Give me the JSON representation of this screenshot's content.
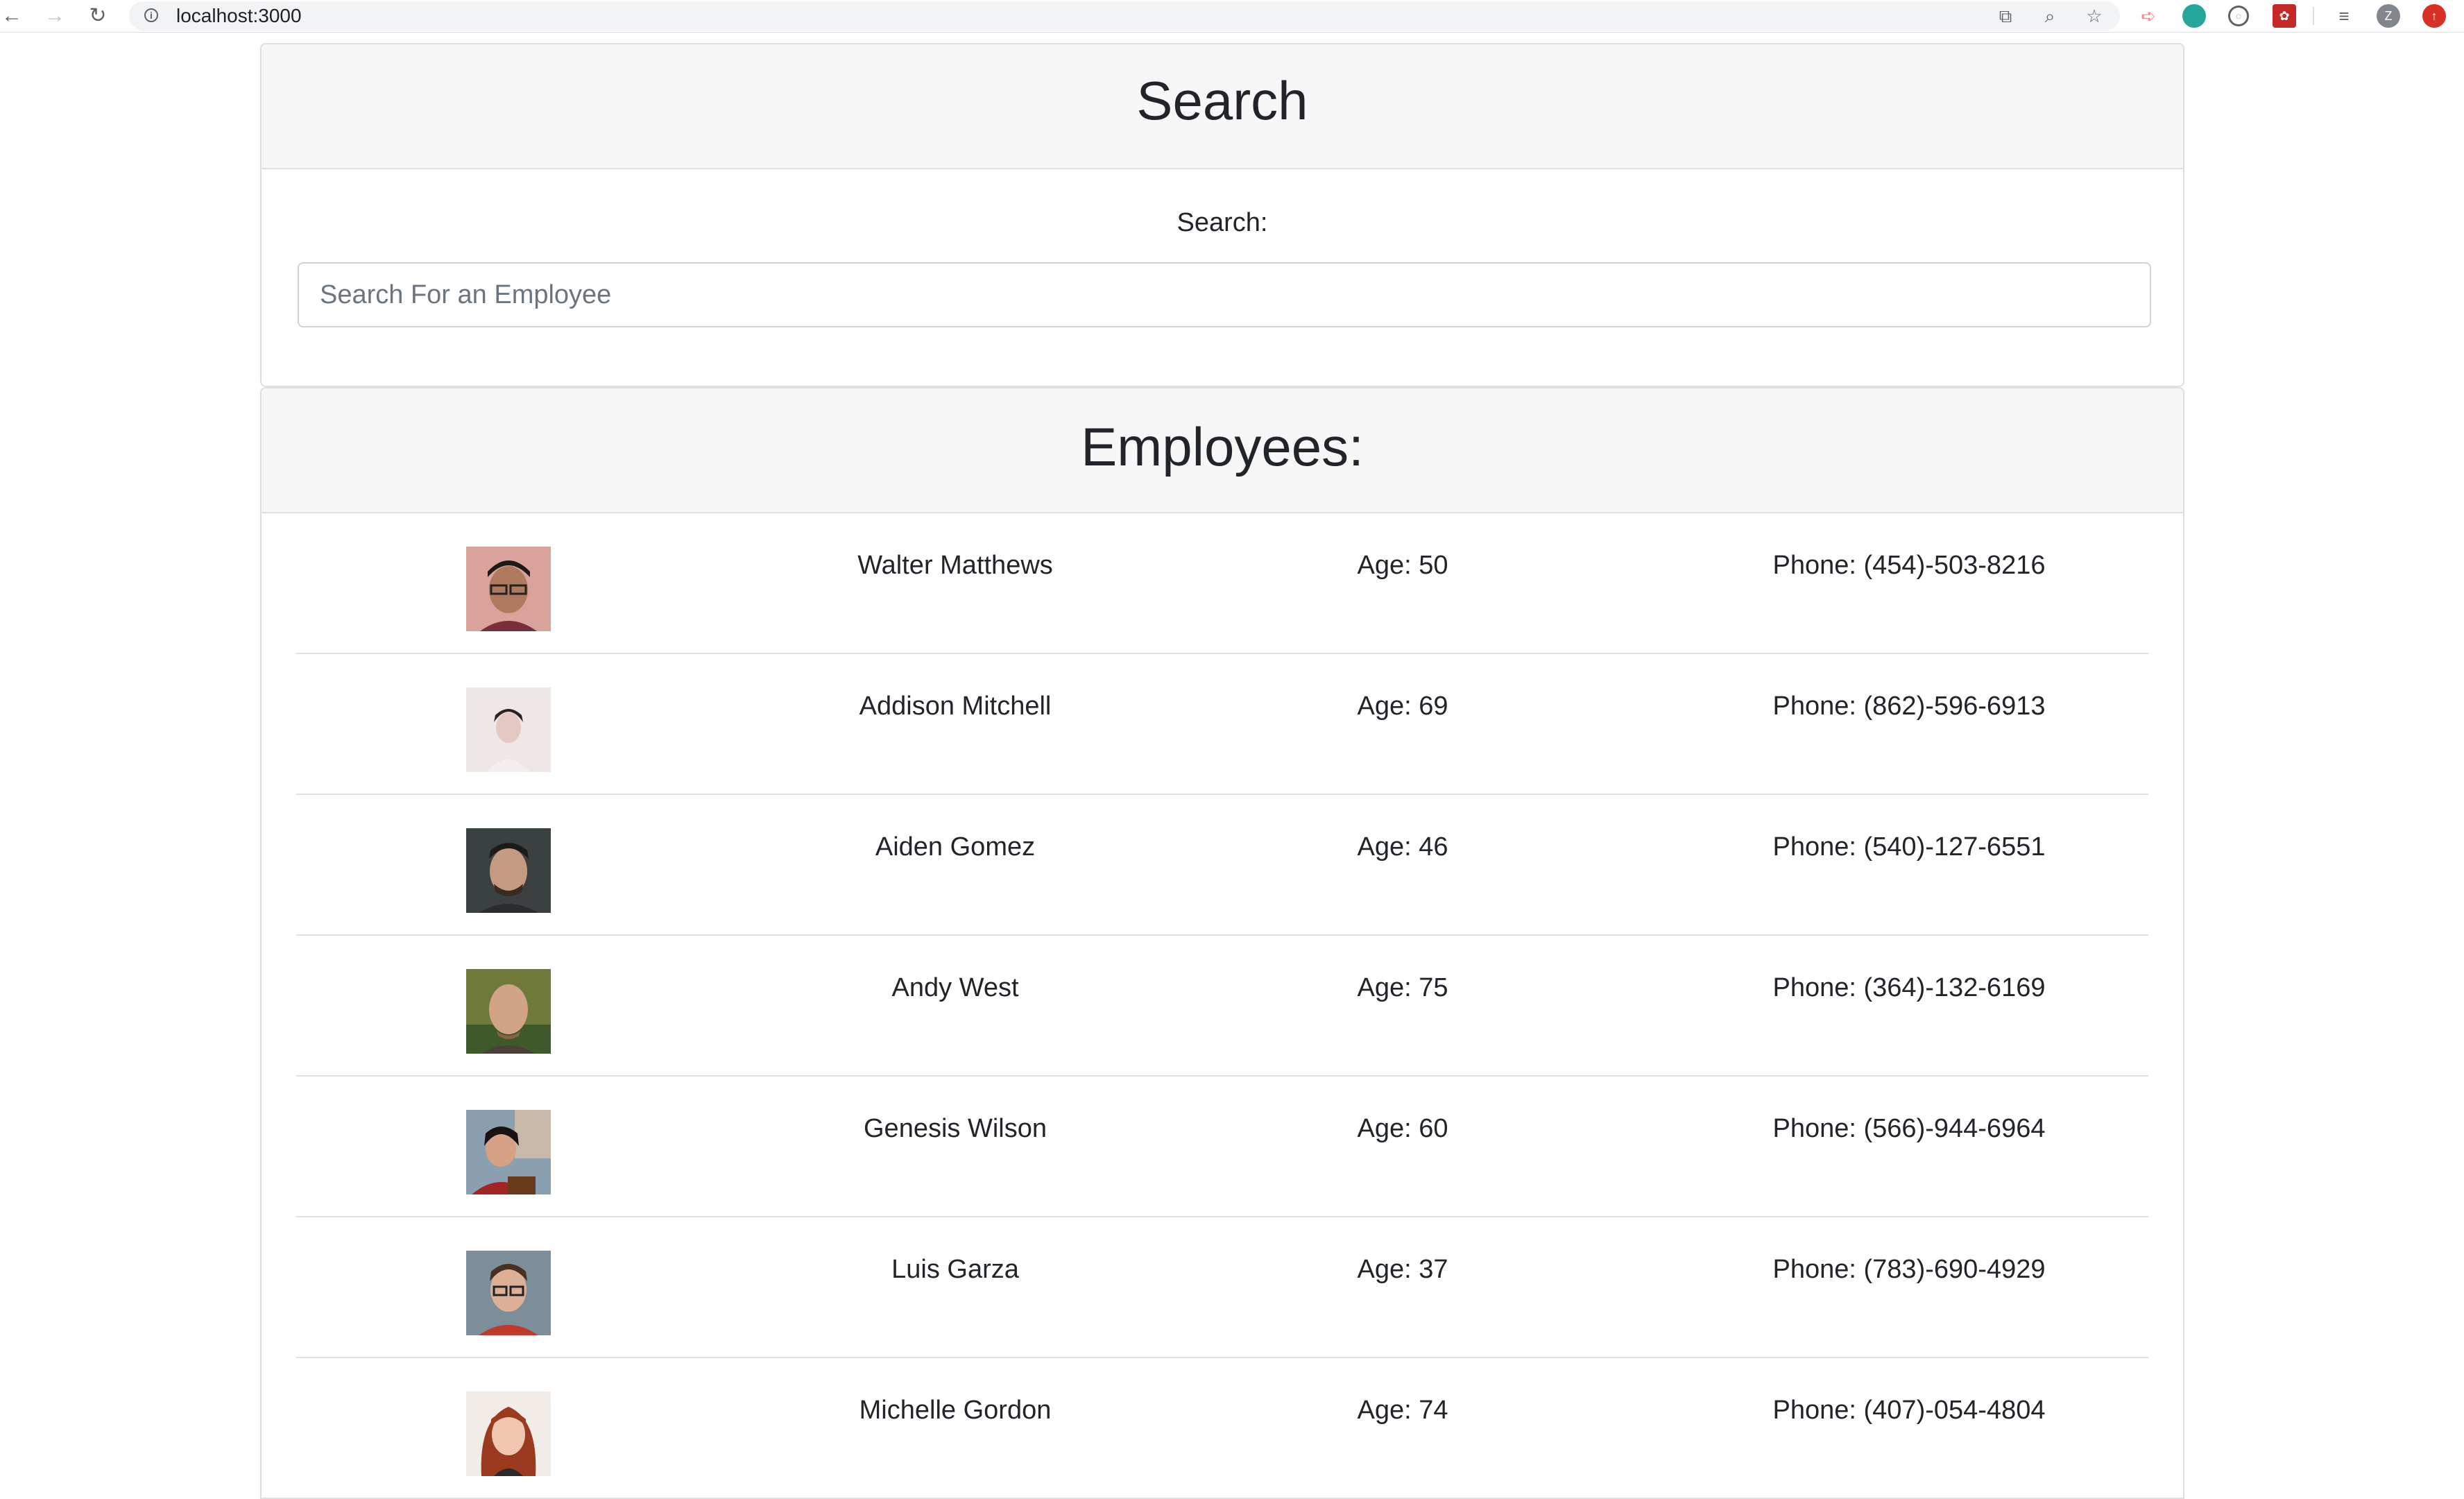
{
  "browser": {
    "url": "localhost:3000",
    "profile_initial": "Z"
  },
  "search": {
    "heading": "Search",
    "label": "Search:",
    "placeholder": "Search For an Employee"
  },
  "employees": {
    "heading": "Employees:",
    "rows": [
      {
        "name": "Walter Matthews",
        "age": "Age: 50",
        "phone": "Phone: (454)-503-8216"
      },
      {
        "name": "Addison Mitchell",
        "age": "Age: 69",
        "phone": "Phone: (862)-596-6913"
      },
      {
        "name": "Aiden Gomez",
        "age": "Age: 46",
        "phone": "Phone: (540)-127-6551"
      },
      {
        "name": "Andy West",
        "age": "Age: 75",
        "phone": "Phone: (364)-132-6169"
      },
      {
        "name": "Genesis Wilson",
        "age": "Age: 60",
        "phone": "Phone: (566)-944-6964"
      },
      {
        "name": "Luis Garza",
        "age": "Age: 37",
        "phone": "Phone: (783)-690-4929"
      },
      {
        "name": "Michelle Gordon",
        "age": "Age: 74",
        "phone": "Phone: (407)-054-4804"
      }
    ]
  }
}
